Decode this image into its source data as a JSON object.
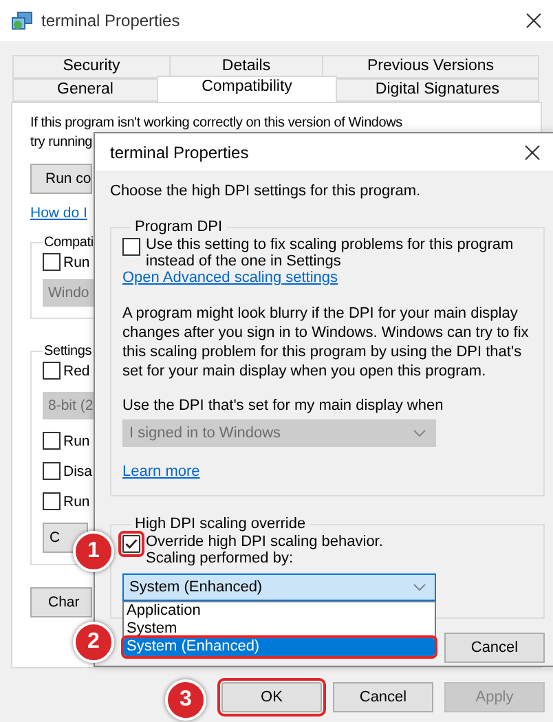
{
  "window": {
    "title": "terminal Properties"
  },
  "tab_rows": [
    [
      {
        "label": "Security",
        "selected": false
      },
      {
        "label": "Details",
        "selected": false
      },
      {
        "label": "Previous Versions",
        "selected": false
      }
    ],
    [
      {
        "label": "General",
        "selected": false
      },
      {
        "label": "Compatibility",
        "selected": true
      },
      {
        "label": "Digital Signatures",
        "selected": false
      }
    ]
  ],
  "panel": {
    "intro_lines": [
      "If this program isn't working correctly on this version of Windows",
      "try running"
    ],
    "run_button": "Run co",
    "help_link": "How do I",
    "compat_group": {
      "title": "Compati",
      "items": [
        {
          "kind": "checkbox",
          "label": "Run",
          "checked": false
        },
        {
          "kind": "dropdown",
          "value": "Windo",
          "disabled": true
        }
      ]
    },
    "settings_group": {
      "title": "Settings",
      "items": [
        {
          "kind": "checkbox",
          "label": "Red",
          "checked": false
        },
        {
          "kind": "dropdown",
          "value": "8-bit (2",
          "disabled": true
        },
        {
          "kind": "checkbox",
          "label": "Run",
          "checked": false
        },
        {
          "kind": "checkbox",
          "label": "Disa",
          "checked": false
        },
        {
          "kind": "checkbox",
          "label": "Run",
          "checked": false
        },
        {
          "kind": "button",
          "label": "C"
        }
      ]
    },
    "change_button": "Char"
  },
  "buttons": [
    {
      "label": "OK",
      "disabled": false,
      "callout": true
    },
    {
      "label": "Cancel",
      "disabled": false,
      "callout": false
    },
    {
      "label": "Apply",
      "disabled": true,
      "callout": false
    }
  ],
  "dialog": {
    "title": "terminal Properties",
    "prompt": "Choose the high DPI settings for this program.",
    "program_dpi": {
      "title": "Program DPI",
      "checkbox": {
        "label": "Use this setting to fix scaling problems for this program instead of the one in Settings",
        "checked": false,
        "callout": false
      },
      "link": "Open Advanced scaling settings",
      "description": "A program might look blurry if the DPI for your main display changes after you sign in to Windows. Windows can try to fix this scaling problem for this program by using the DPI that's set for your main display when you open this program.",
      "dropdown_label": "Use the DPI that's set for my main display when",
      "dropdown": {
        "value": "I signed in to Windows",
        "disabled": true
      },
      "learn_more": "Learn more"
    },
    "override": {
      "title": "High DPI scaling override",
      "checkbox": {
        "label": "Override high DPI scaling behavior.",
        "sublabel": "Scaling performed by:",
        "checked": true,
        "callout": true
      },
      "dropdown": {
        "value": "System (Enhanced)",
        "disabled": false,
        "expanded": true,
        "options": [
          {
            "label": "Application",
            "selected": false,
            "callout": false
          },
          {
            "label": "System",
            "selected": false,
            "callout": false
          },
          {
            "label": "System (Enhanced)",
            "selected": true,
            "callout": true
          }
        ]
      }
    },
    "buttons": [
      {
        "label": "Cancel"
      }
    ]
  },
  "badges": [
    {
      "number": "1"
    },
    {
      "number": "2"
    },
    {
      "number": "3"
    }
  ]
}
